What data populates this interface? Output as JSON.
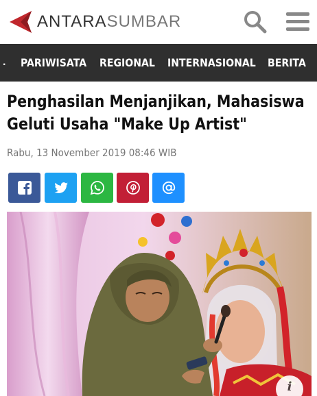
{
  "header": {
    "logo_main": "ANTARA",
    "logo_region": "SUMBAR",
    "brand_color": "#c0272d",
    "search_icon": "search-icon",
    "menu_icon": "hamburger-menu-icon"
  },
  "nav": {
    "overflow_marker": ".",
    "items": [
      {
        "label": "PARIWISATA"
      },
      {
        "label": "REGIONAL"
      },
      {
        "label": "INTERNASIONAL"
      },
      {
        "label": "BERITA"
      }
    ],
    "background": "#2f2f2f"
  },
  "article": {
    "title": "Penghasilan Menjanjikan, Mahasiswa Geluti Usaha \"Make Up Artist\"",
    "date": "Rabu, 13 November 2019 08:46 WIB"
  },
  "share": {
    "buttons": [
      {
        "icon": "facebook-icon",
        "color": "#3b5998"
      },
      {
        "icon": "twitter-icon",
        "color": "#1da1f2"
      },
      {
        "icon": "whatsapp-icon",
        "color": "#2cb742"
      },
      {
        "icon": "pinterest-icon",
        "color": "#c21f36"
      },
      {
        "icon": "email-at-icon",
        "color": "#1e90ff"
      }
    ]
  },
  "photo": {
    "info_icon": "info-icon",
    "info_glyph": "i"
  }
}
